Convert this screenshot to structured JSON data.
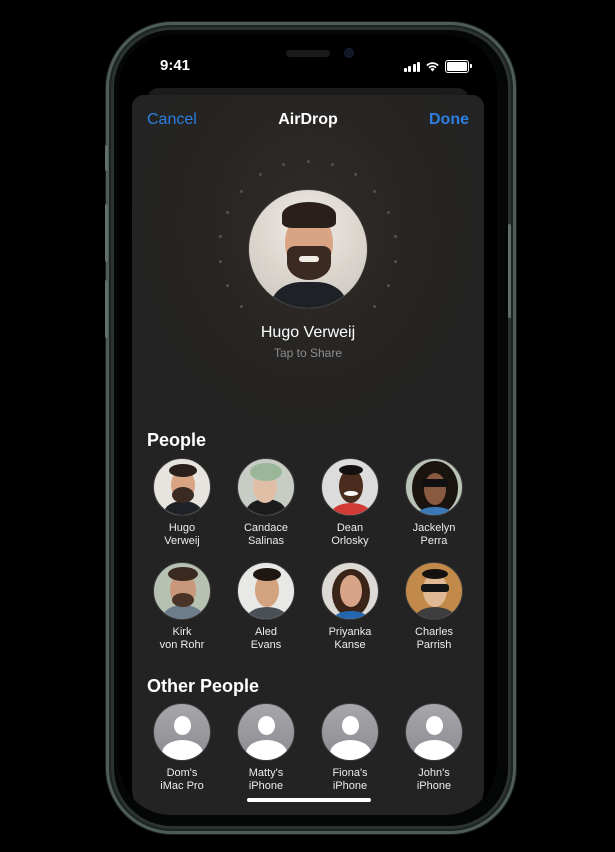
{
  "status_bar": {
    "time": "9:41",
    "signal_icon": "cellular-signal-icon",
    "wifi_icon": "wifi-icon",
    "battery_icon": "battery-icon",
    "battery_level": 1.0
  },
  "nav": {
    "cancel_label": "Cancel",
    "title": "AirDrop",
    "done_label": "Done",
    "accent_color": "#2c7ee0"
  },
  "hero": {
    "name": "Hugo Verweij",
    "subtitle": "Tap to Share"
  },
  "people": {
    "title": "People",
    "items": [
      {
        "label": "Hugo\nVerweij"
      },
      {
        "label": "Candace\nSalinas"
      },
      {
        "label": "Dean\nOrlosky"
      },
      {
        "label": "Jackelyn\nPerra"
      },
      {
        "label": "Kirk\nvon Rohr"
      },
      {
        "label": "Aled\nEvans"
      },
      {
        "label": "Priyanka\nKanse"
      },
      {
        "label": "Charles\nParrish"
      }
    ]
  },
  "other_people": {
    "title": "Other People",
    "items": [
      {
        "label": "Dom's\niMac Pro",
        "icon": "person-placeholder-icon"
      },
      {
        "label": "Matty's\niPhone",
        "icon": "person-placeholder-icon"
      },
      {
        "label": "Fiona's\niPhone",
        "icon": "person-placeholder-icon"
      },
      {
        "label": "John's\niPhone",
        "icon": "person-placeholder-icon"
      }
    ]
  }
}
